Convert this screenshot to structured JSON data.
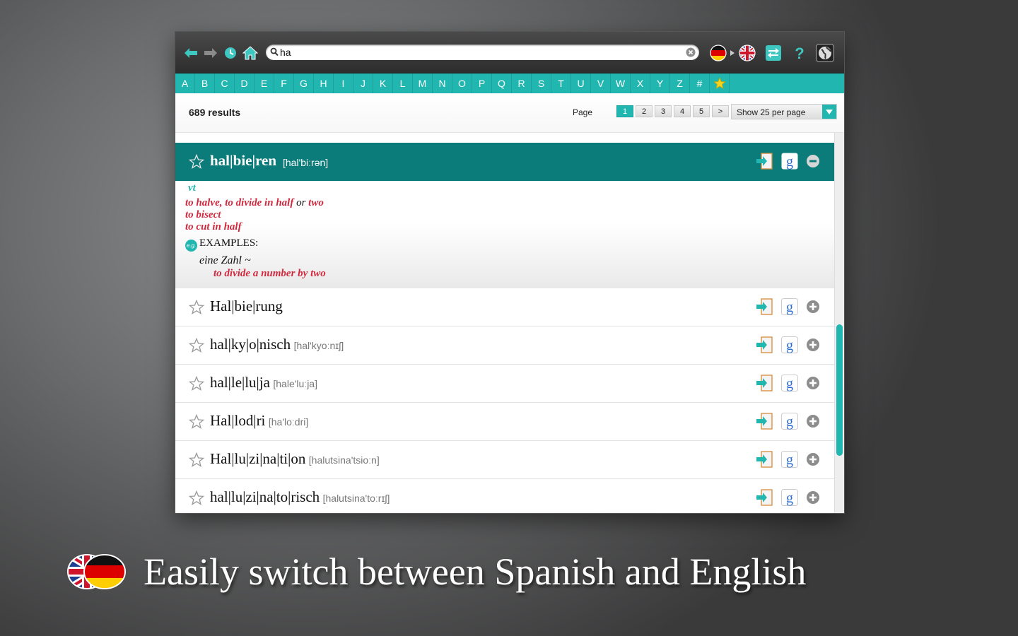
{
  "toolbar": {
    "search_value": "ha",
    "icons": [
      "back-arrow-icon",
      "forward-arrow-icon",
      "history-icon",
      "home-icon",
      "clear-icon",
      "german-flag-icon",
      "uk-flag-icon",
      "swap-icon",
      "help-icon",
      "globe-icon"
    ]
  },
  "alphabet": [
    "A",
    "B",
    "C",
    "D",
    "E",
    "F",
    "G",
    "H",
    "I",
    "J",
    "K",
    "L",
    "M",
    "N",
    "O",
    "P",
    "Q",
    "R",
    "S",
    "T",
    "U",
    "V",
    "W",
    "X",
    "Y",
    "Z",
    "#"
  ],
  "results": {
    "count": "689 results",
    "page_label": "Page",
    "pages": [
      "1",
      "2",
      "3",
      "4",
      "5"
    ],
    "next": ">",
    "per_page": "Show 25 per page"
  },
  "expanded": {
    "word": "hal|bie|ren",
    "pron": "[hal'biːrən]",
    "pos": "vt",
    "def1a": "to halve, to divide in half",
    "def1_or": "or",
    "def1b": "two",
    "def2": "to bisect",
    "def3": "to cut in half",
    "eg_badge": "e.g.",
    "examples_label": "EXAMPLES:",
    "example_de": "eine Zahl ~",
    "example_en": "to divide a number by two"
  },
  "entries": [
    {
      "word": "Hal|bie|rung",
      "pron": ""
    },
    {
      "word": "hal|ky|o|nisch",
      "pron": "[hal'kyoːnɪʃ]"
    },
    {
      "word": "hal|le|lu|ja",
      "pron": "[hale'luːja]"
    },
    {
      "word": "Hal|lod|ri",
      "pron": "[ha'loːdri]"
    },
    {
      "word": "Hal|lu|zi|na|ti|on",
      "pron": "[halutsina'tsioːn]"
    },
    {
      "word": "hal|lu|zi|na|to|risch",
      "pron": "[halutsina'toːrɪʃ]"
    }
  ],
  "caption": "Easily switch between Spanish and English",
  "colors": {
    "accent": "#21b6b0",
    "header": "#0b7c7a",
    "definition": "#d1283e"
  }
}
